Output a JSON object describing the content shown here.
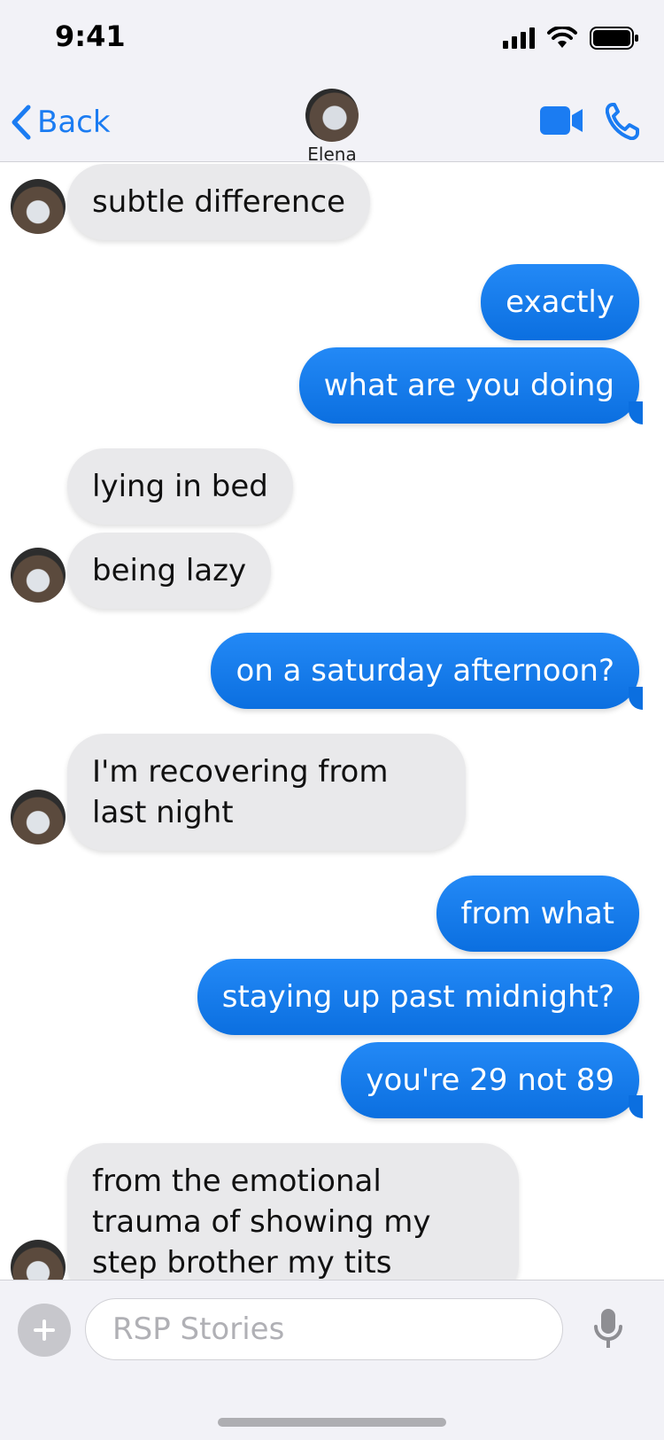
{
  "status_bar": {
    "time": "9:41"
  },
  "nav": {
    "back_label": "Back",
    "contact_name": "Elena"
  },
  "messages": [
    {
      "from": "them",
      "text": "subtle difference"
    },
    {
      "from": "me",
      "text": "exactly"
    },
    {
      "from": "me",
      "text": "what are you doing"
    },
    {
      "from": "them",
      "text": "lying in bed"
    },
    {
      "from": "them",
      "text": "being lazy"
    },
    {
      "from": "me",
      "text": "on a saturday afternoon?"
    },
    {
      "from": "them",
      "text": "I'm recovering from last night"
    },
    {
      "from": "me",
      "text": "from what"
    },
    {
      "from": "me",
      "text": "staying up past midnight?"
    },
    {
      "from": "me",
      "text": "you're 29 not 89"
    },
    {
      "from": "them",
      "text": "from the emotional trauma of showing my step brother my tits"
    }
  ],
  "composer": {
    "placeholder": "RSP Stories"
  },
  "colors": {
    "accent": "#1b7cf2",
    "outgoing_bubble": "#0b6fe0",
    "incoming_bubble": "#e9e9eb"
  }
}
